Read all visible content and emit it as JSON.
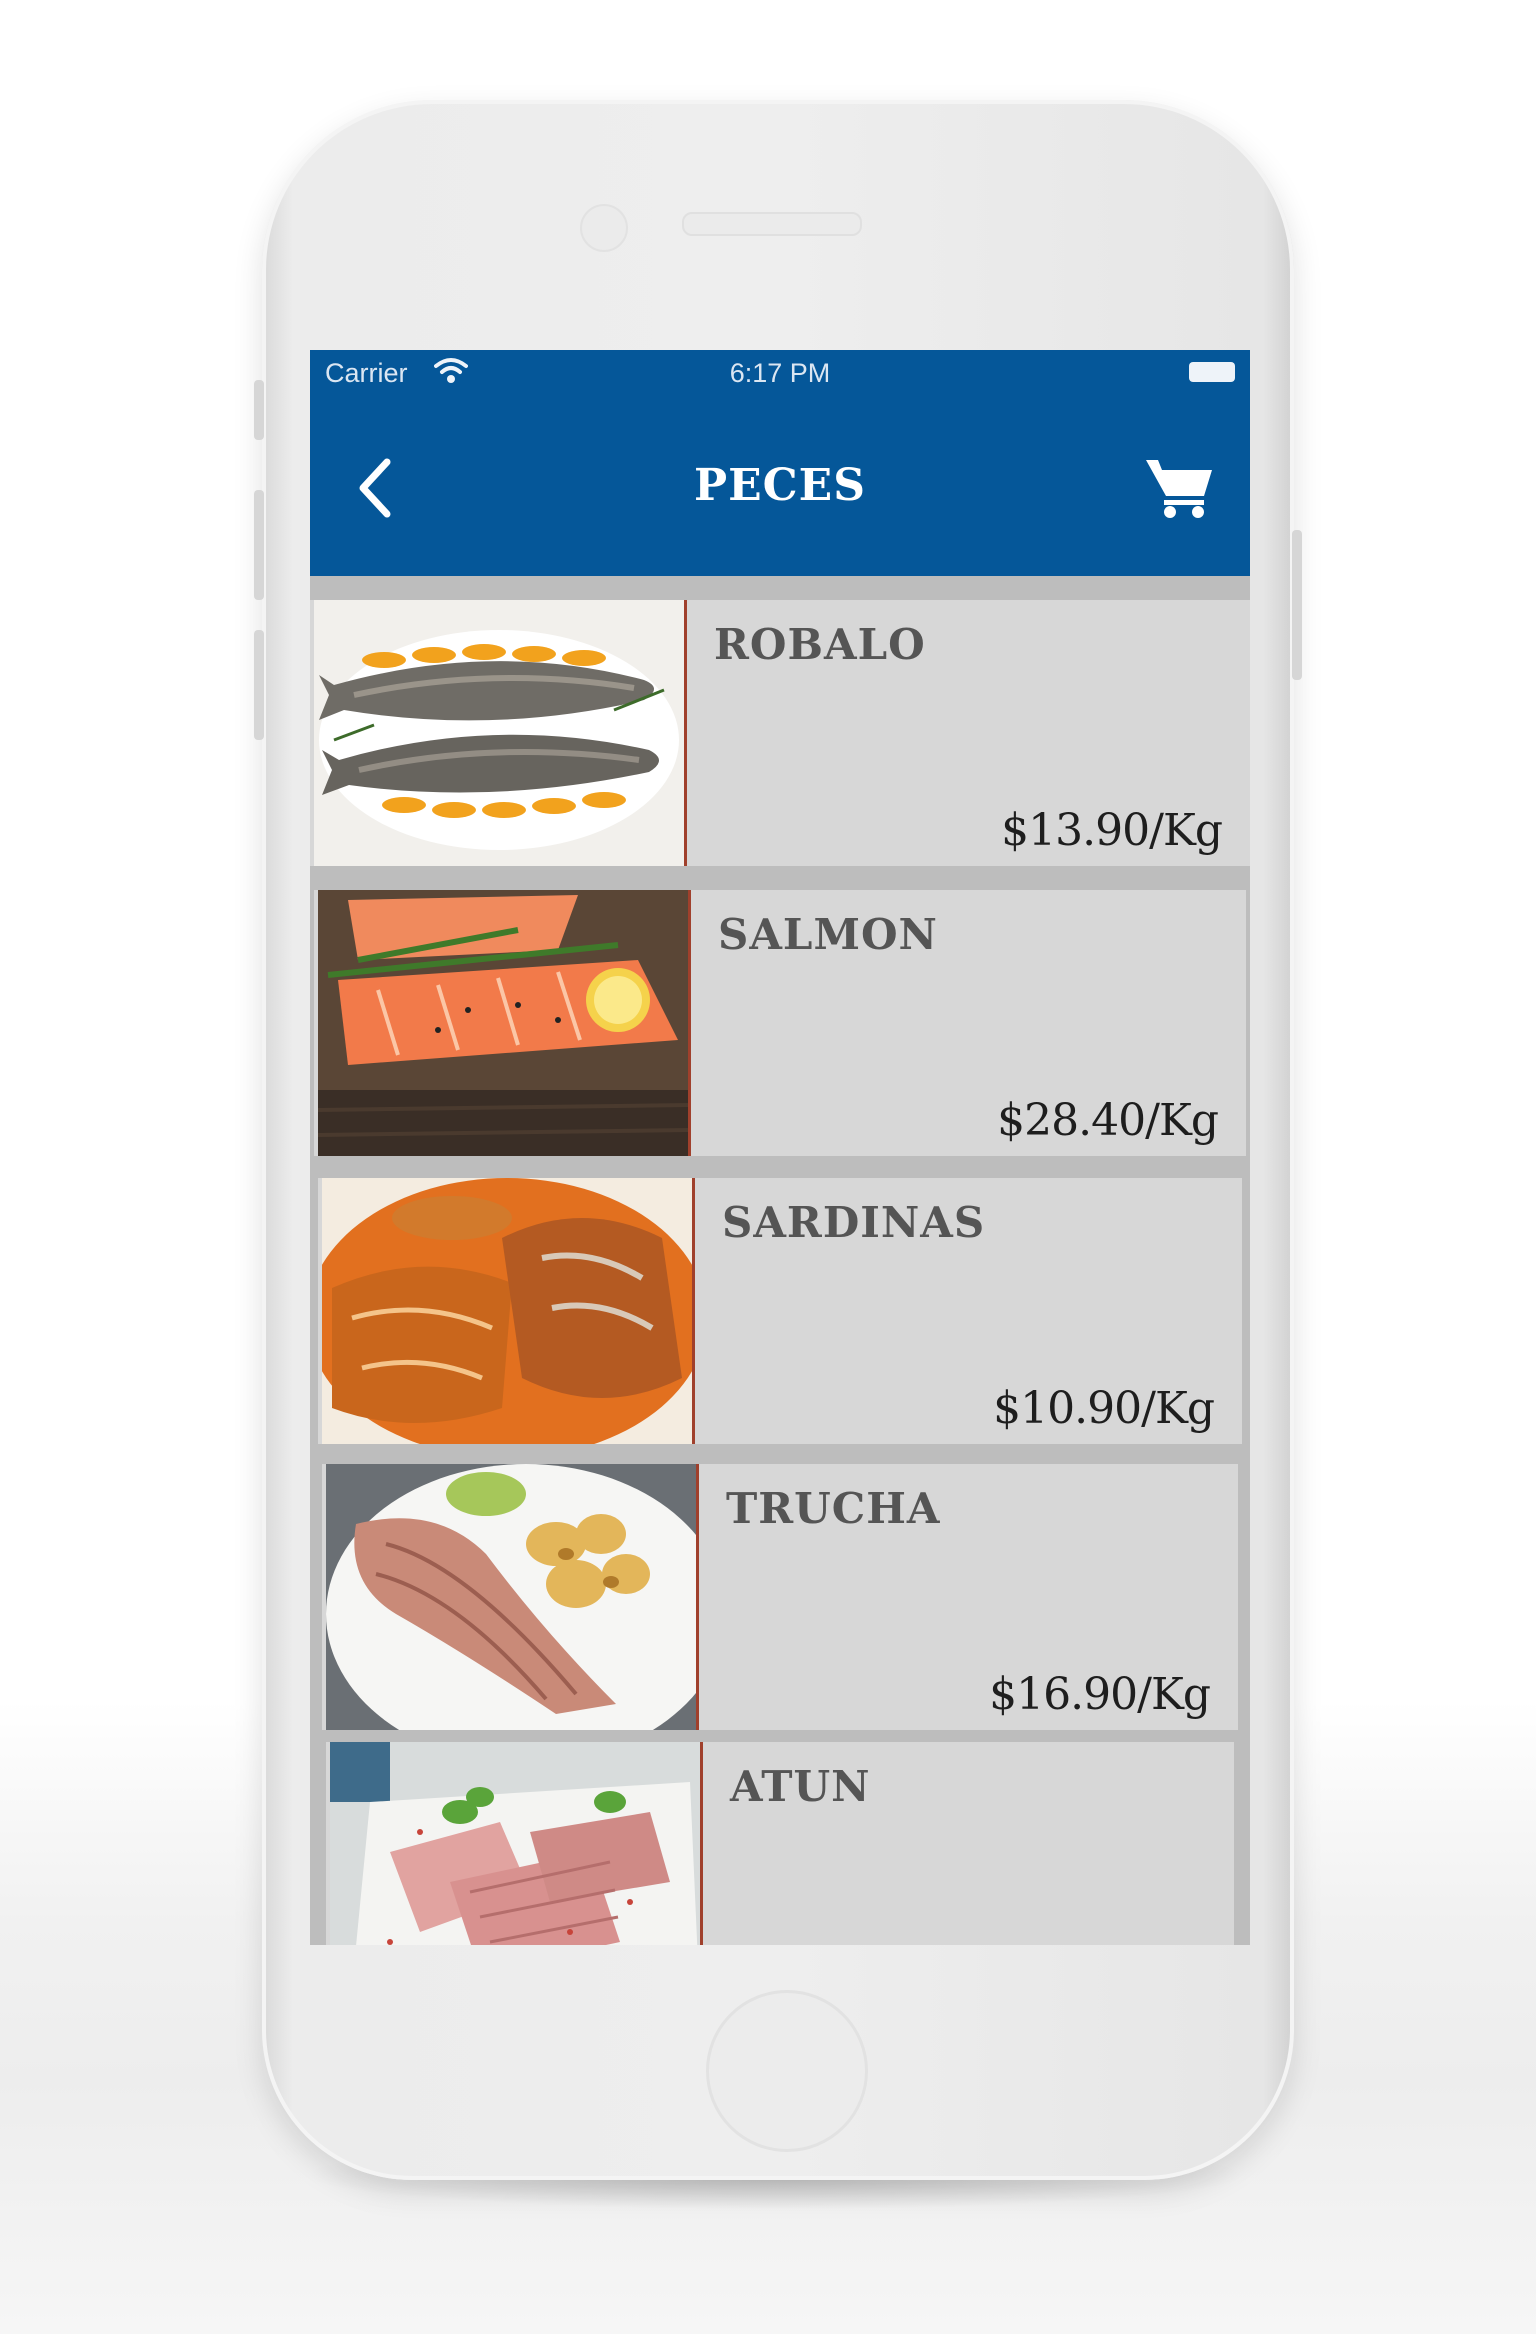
{
  "status_bar": {
    "carrier": "Carrier",
    "time": "6:17 PM"
  },
  "nav": {
    "title": "PECES",
    "back_icon": "chevron-left-icon",
    "cart_icon": "cart-icon"
  },
  "colors": {
    "brand": "#055799",
    "row_background": "#d7d7d7",
    "separator": "#bdbdbd",
    "thumb_border": "#a0402c"
  },
  "products": [
    {
      "name": "ROBALO",
      "price": "$13.90/Kg",
      "image": "grilled-fish-photo"
    },
    {
      "name": "SALMON",
      "price": "$28.40/Kg",
      "image": "salmon-fillet-photo"
    },
    {
      "name": "SARDINAS",
      "price": "$10.90/Kg",
      "image": "sardines-in-sauce-photo"
    },
    {
      "name": "TRUCHA",
      "price": "$16.90/Kg",
      "image": "trout-plate-photo"
    },
    {
      "name": "ATUN",
      "price": "",
      "image": "tuna-steak-photo"
    }
  ]
}
